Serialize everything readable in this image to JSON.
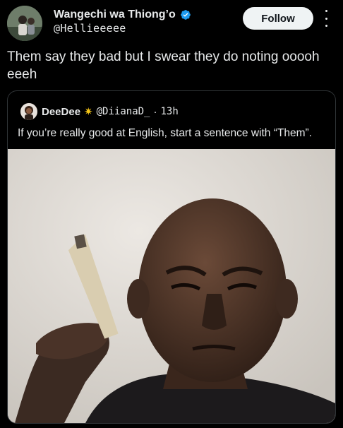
{
  "author": {
    "display_name": "Wangechi wa Thiong’o",
    "handle": "@Hellieeeee",
    "verified": true
  },
  "actions": {
    "follow_label": "Follow",
    "more_icon": "more-vertical-icon"
  },
  "tweet": {
    "text": "Them say they bad but I swear they do noting ooooh eeeh"
  },
  "quoted": {
    "display_name": "DeeDee",
    "name_emoji": "✷",
    "handle": "@DiianaD_",
    "separator": "·",
    "time": "13h",
    "text": "If you’re really good at English, start a sentence with “Them”.",
    "media_alt": "photo-man-holding-cigarette"
  },
  "colors": {
    "background": "#000000",
    "text": "#e7e9ea",
    "verified": "#1d9bf0",
    "follow_bg": "#eff3f4",
    "border": "#2f3336"
  }
}
